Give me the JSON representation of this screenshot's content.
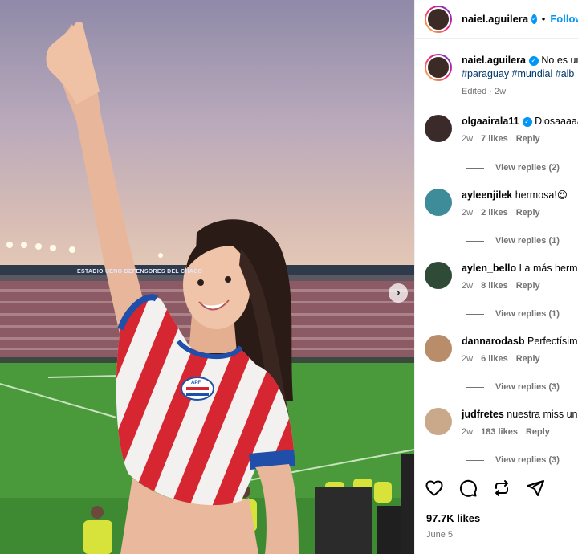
{
  "post": {
    "username": "naiel.aguilera",
    "follow_label": "Follow",
    "dot": "•",
    "caption_text": "No es un",
    "hashtags": "#paraguay #mundial #alb",
    "caption_meta": "Edited · 2w",
    "likes_count": "97.7K likes",
    "date": "June 5"
  },
  "photo": {
    "stadium_sign": "ESTADIO UENO DEFENSORES DEL CHACO",
    "crest_text": "APF"
  },
  "comments": [
    {
      "username": "olgaairala11",
      "verified": true,
      "text": "Diosaaaaa",
      "time": "2w",
      "likes": "7 likes",
      "reply": "Reply",
      "replies": "View replies (2)",
      "avatar_color": "#3a2a2a"
    },
    {
      "username": "ayleenjilek",
      "verified": false,
      "text": "hermosa!😍",
      "time": "2w",
      "likes": "2 likes",
      "reply": "Reply",
      "replies": "View replies (1)",
      "avatar_color": "#3e8b9a"
    },
    {
      "username": "aylen_bello",
      "verified": false,
      "text": "La más hermo",
      "time": "2w",
      "likes": "8 likes",
      "reply": "Reply",
      "replies": "View replies (1)",
      "avatar_color": "#2f4a36"
    },
    {
      "username": "dannarodasb",
      "verified": false,
      "text": "Perfectísima",
      "time": "2w",
      "likes": "6 likes",
      "reply": "Reply",
      "replies": "View replies (3)",
      "avatar_color": "#b98c6a"
    },
    {
      "username": "judfretes",
      "verified": false,
      "text": "nuestra miss uni",
      "time": "2w",
      "likes": "183 likes",
      "reply": "Reply",
      "replies": "View replies (3)",
      "avatar_color": "#c9a98a"
    }
  ],
  "icons": [
    "heart-icon",
    "comment-icon",
    "repost-icon",
    "share-icon",
    "chevron-right-icon",
    "verified-icon"
  ],
  "colors": {
    "link": "#0095f6",
    "hashtag": "#00376b",
    "muted": "#737373",
    "jersey_red": "#d62631",
    "jersey_blue": "#1f4fa8"
  }
}
